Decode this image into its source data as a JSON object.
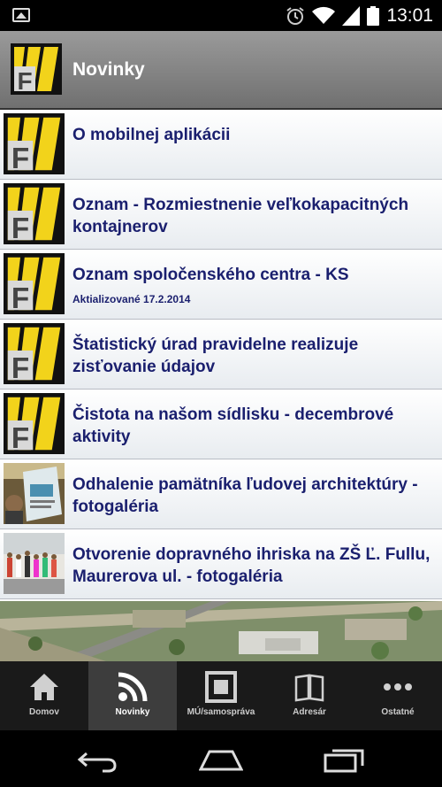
{
  "status_bar": {
    "time": "13:01",
    "icons": [
      "image-notification-icon",
      "alarm-icon",
      "wifi-icon",
      "signal-icon",
      "battery-icon"
    ]
  },
  "action_bar": {
    "title": "Novinky",
    "logo_letter": "F"
  },
  "news": [
    {
      "title": "O mobilnej aplikácii",
      "subtitle": "",
      "thumb": "logo"
    },
    {
      "title": "Oznam - Rozmiestnenie veľkokapacitných kontajnerov",
      "subtitle": "",
      "thumb": "logo"
    },
    {
      "title": "Oznam spoločenského centra - KS",
      "subtitle": "Aktializované 17.2.2014",
      "thumb": "logo"
    },
    {
      "title": "Štatistický úrad pravidelne realizuje zisťovanie údajov",
      "subtitle": "",
      "thumb": "logo"
    },
    {
      "title": "Čistota na našom sídlisku - decembrové aktivity",
      "subtitle": "",
      "thumb": "logo"
    },
    {
      "title": "Odhalenie pamätníka ľudovej architektúry - fotogaléria",
      "subtitle": "",
      "thumb": "photo-poster"
    },
    {
      "title": "Otvorenie dopravného ihriska na ZŠ Ľ. Fullu, Maurerova ul. - fotogaléria",
      "subtitle": "",
      "thumb": "photo-children"
    }
  ],
  "tabs": [
    {
      "label": "Domov",
      "icon": "home-icon",
      "active": false
    },
    {
      "label": "Novinky",
      "icon": "rss-icon",
      "active": true
    },
    {
      "label": "MÚ/samospráva",
      "icon": "building-icon",
      "active": false
    },
    {
      "label": "Adresár",
      "icon": "book-icon",
      "active": false
    },
    {
      "label": "Ostatné",
      "icon": "more-icon",
      "active": false
    }
  ],
  "nav_bar": [
    "back-icon",
    "home-nav-icon",
    "recents-icon"
  ],
  "colors": {
    "title_text": "#1a1f6e",
    "logo_yellow": "#f2d31b",
    "tab_active": "#3d3d3d"
  }
}
